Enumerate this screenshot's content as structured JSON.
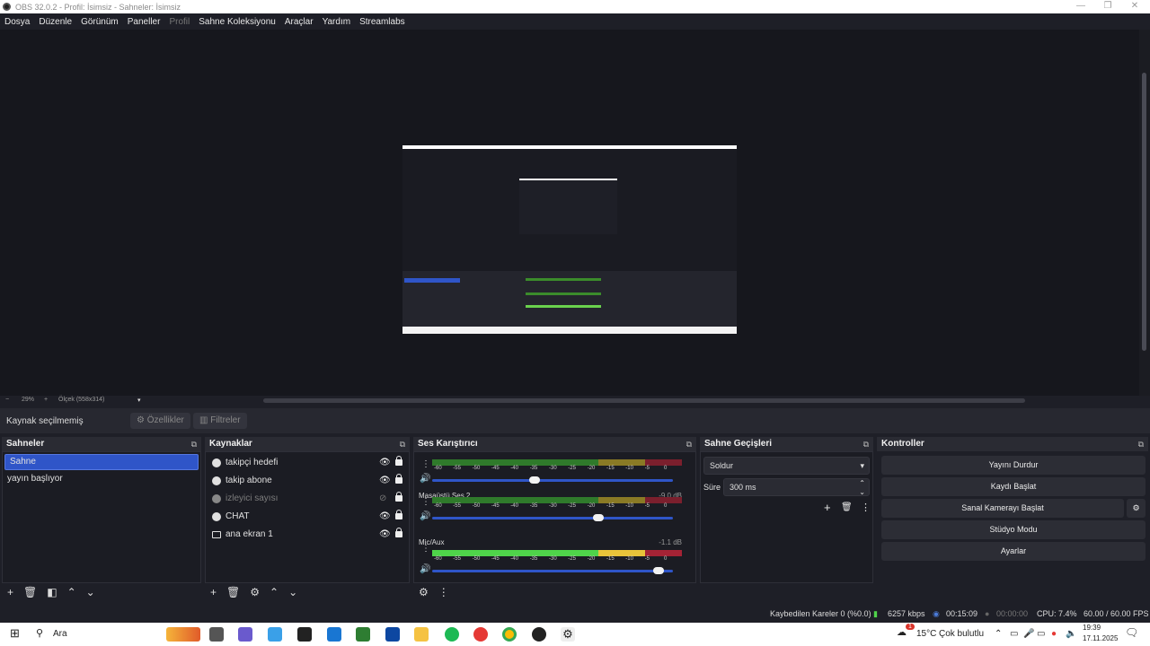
{
  "window": {
    "title": "OBS 32.0.2 - Profil: İsimsiz - Sahneler: İsimsiz",
    "minimize": "—",
    "restore": "❐",
    "close": "✕"
  },
  "menu": [
    "Dosya",
    "Düzenle",
    "Görünüm",
    "Paneller",
    "Profil",
    "Sahne Koleksiyonu",
    "Araçlar",
    "Yardım",
    "Streamlabs"
  ],
  "preview": {
    "zoom_minus": "−",
    "zoom_value": "29%",
    "zoom_plus": "+",
    "scale_label": "Ölçek (558x314)",
    "scale_dropdown": "▾"
  },
  "source_toolbar": {
    "no_source": "Kaynak seçilmemiş",
    "properties": "Özellikler",
    "filters": "Filtreler"
  },
  "scenes": {
    "title": "Sahneler",
    "items": [
      "Sahne",
      "yayın başlıyor"
    ],
    "selected": "Sahne"
  },
  "sources": {
    "title": "Kaynaklar",
    "items": [
      {
        "label": "takipçi hedefi",
        "icon": "globe-icon",
        "visible": true
      },
      {
        "label": "takip abone",
        "icon": "globe-icon",
        "visible": true
      },
      {
        "label": "izleyici sayısı",
        "icon": "globe-icon",
        "visible": false
      },
      {
        "label": "CHAT",
        "icon": "globe-icon",
        "visible": true
      },
      {
        "label": "ana ekran 1",
        "icon": "monitor-icon",
        "visible": true
      }
    ]
  },
  "mixer": {
    "title": "Ses Karıştırıcı",
    "ticks": [
      "-60",
      "-55",
      "-50",
      "-45",
      "-40",
      "-35",
      "-30",
      "-25",
      "-20",
      "-15",
      "-10",
      "-5",
      "0"
    ],
    "channels": [
      {
        "name": "",
        "db": "",
        "volume": 0.42
      },
      {
        "name": "Masaüstü Ses 2",
        "db": "-9.0 dB",
        "volume": 0.7
      },
      {
        "name": "Mic/Aux",
        "db": "-1.1 dB",
        "volume": 0.96
      }
    ]
  },
  "transitions": {
    "title": "Sahne Geçişleri",
    "selected": "Soldur",
    "duration_label": "Süre",
    "duration_value": "300 ms"
  },
  "controls": {
    "title": "Kontroller",
    "buttons": [
      "Yayını Durdur",
      "Kaydı Başlat",
      "Sanal Kamerayı Başlat",
      "Stüdyo Modu",
      "Ayarlar"
    ]
  },
  "status": {
    "dropped_frames": "Kaybedilen Kareler 0 (%0.0)",
    "bitrate": "6257 kbps",
    "stream_time": "00:15:09",
    "record_time": "00:00:00",
    "cpu": "CPU: 7.4%",
    "fps": "60.00 / 60.00 FPS"
  },
  "taskbar": {
    "search": "Ara",
    "weather": "15°C",
    "weather_desc": "Çok bulutlu",
    "time": "19:39",
    "date": "17.11.2025",
    "badge": "1"
  },
  "colors": {
    "accent": "#2f55c8",
    "meter_green": "#4fd44a",
    "meter_yellow": "#e8c33a",
    "meter_red": "#a42335"
  }
}
